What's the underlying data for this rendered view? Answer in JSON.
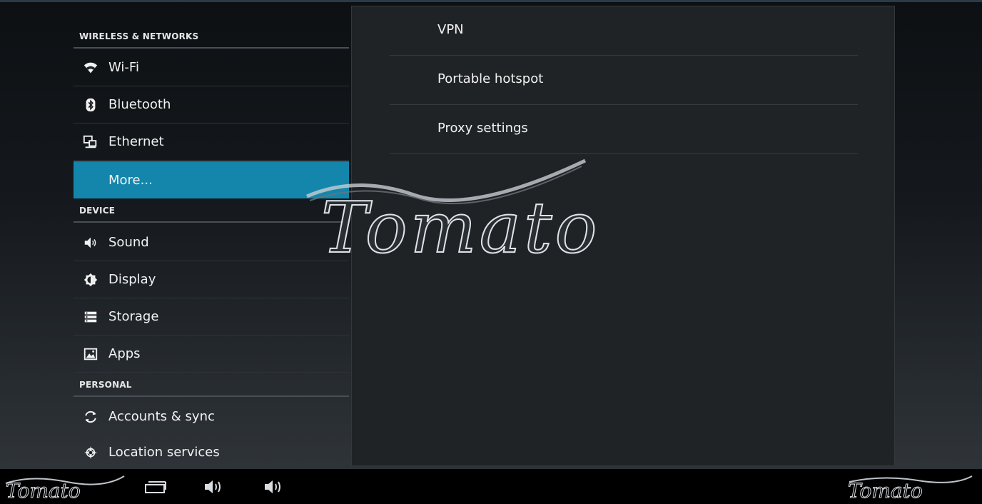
{
  "sections": {
    "wireless": "WIRELESS & NETWORKS",
    "device": "DEVICE",
    "personal": "PERSONAL"
  },
  "left_items": {
    "wifi": {
      "label": "Wi-Fi",
      "icon": "wifi-icon"
    },
    "bluetooth": {
      "label": "Bluetooth",
      "icon": "bluetooth-icon"
    },
    "ethernet": {
      "label": "Ethernet",
      "icon": "ethernet-icon"
    },
    "more": {
      "label": "More...",
      "selected": true
    },
    "sound": {
      "label": "Sound",
      "icon": "sound-icon"
    },
    "display": {
      "label": "Display",
      "icon": "display-icon"
    },
    "storage": {
      "label": "Storage",
      "icon": "storage-icon"
    },
    "apps": {
      "label": "Apps",
      "icon": "apps-icon"
    },
    "accounts": {
      "label": "Accounts & sync",
      "icon": "sync-icon"
    },
    "location": {
      "label": "Location services",
      "icon": "location-icon"
    }
  },
  "right_items": [
    {
      "label": "VPN"
    },
    {
      "label": "Portable hotspot"
    },
    {
      "label": "Proxy settings"
    }
  ],
  "watermark": {
    "text": "Tomato"
  },
  "navbar": {
    "left_logo": "Tomato",
    "right_logo": "Tomato",
    "buttons": [
      "recent-apps-icon",
      "volume-down-icon",
      "volume-up-icon"
    ]
  },
  "colors": {
    "selected": "#1486ab",
    "panel": "#202326",
    "text": "#f2f2f2"
  }
}
